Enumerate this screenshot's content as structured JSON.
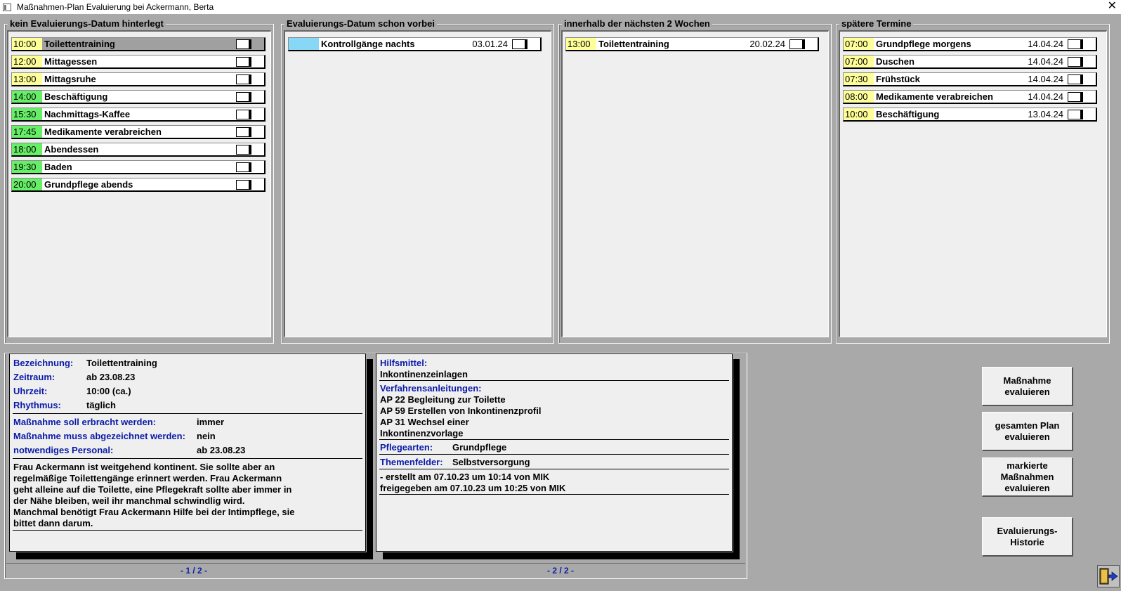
{
  "window": {
    "title": "Maßnahmen-Plan Evaluierung bei Ackermann, Berta",
    "close": "✕"
  },
  "colors": {
    "yellow": "#ffff99",
    "green": "#66ee66",
    "cyan": "#87d8f6"
  },
  "columns": {
    "kein": {
      "title": "kein Evaluierungs-Datum hinterlegt",
      "items": [
        {
          "time": "10:00",
          "label": "Toilettentraining",
          "color": "#ffff99"
        },
        {
          "time": "12:00",
          "label": "Mittagessen",
          "color": "#ffff99"
        },
        {
          "time": "13:00",
          "label": "Mittagsruhe",
          "color": "#ffff99"
        },
        {
          "time": "14:00",
          "label": "Beschäftigung",
          "color": "#66ee66"
        },
        {
          "time": "15:30",
          "label": "Nachmittags-Kaffee",
          "color": "#66ee66"
        },
        {
          "time": "17:45",
          "label": "Medikamente verabreichen",
          "color": "#66ee66"
        },
        {
          "time": "18:00",
          "label": "Abendessen",
          "color": "#66ee66"
        },
        {
          "time": "19:30",
          "label": "Baden",
          "color": "#66ee66"
        },
        {
          "time": "20:00",
          "label": "Grundpflege abends",
          "color": "#66ee66"
        }
      ]
    },
    "vorbei": {
      "title": "Evaluierungs-Datum schon vorbei",
      "items": [
        {
          "time": "",
          "label": "Kontrollgänge nachts",
          "date": "03.01.24",
          "color": "#87d8f6"
        }
      ]
    },
    "zwei_wochen": {
      "title": "innerhalb der nächsten 2 Wochen",
      "items": [
        {
          "time": "13:00",
          "label": "Toilettentraining",
          "date": "20.02.24",
          "color": "#ffff99"
        }
      ]
    },
    "spaeter": {
      "title": "spätere Termine",
      "items": [
        {
          "time": "07:00",
          "label": "Grundpflege morgens",
          "date": "14.04.24",
          "color": "#ffff99"
        },
        {
          "time": "07:00",
          "label": "Duschen",
          "date": "14.04.24",
          "color": "#ffff99"
        },
        {
          "time": "07:30",
          "label": "Frühstück",
          "date": "14.04.24",
          "color": "#ffff99"
        },
        {
          "time": "08:00",
          "label": "Medikamente verabreichen",
          "date": "14.04.24",
          "color": "#ffff99"
        },
        {
          "time": "10:00",
          "label": "Beschäftigung",
          "date": "13.04.24",
          "color": "#ffff99"
        }
      ]
    }
  },
  "detail": {
    "bezeichnung_label": "Bezeichnung:",
    "bezeichnung": "Toilettentraining",
    "zeitraum_label": "Zeitraum:",
    "zeitraum": "ab 23.08.23",
    "uhrzeit_label": "Uhrzeit:",
    "uhrzeit": "10:00 (ca.)",
    "rhythmus_label": "Rhythmus:",
    "rhythmus": "täglich",
    "erbracht_label": "Maßnahme soll erbracht werden:",
    "erbracht": "immer",
    "abgezeichnet_label": "Maßnahme muss abgezeichnet werden:",
    "abgezeichnet": "nein",
    "personal_label": "notwendiges Personal:",
    "personal": "ab 23.08.23",
    "beschreibung": [
      "Frau Ackermann ist weitgehend kontinent. Sie sollte aber an",
      "regelmäßige Toilettengänge erinnert werden. Frau Ackermann",
      "geht alleine auf die Toilette, eine Pflegekraft sollte aber immer in",
      "der Nähe bleiben, weil ihr manchmal schwindlig wird.",
      "Manchmal benötigt Frau Ackermann Hilfe bei der Intimpflege, sie",
      "bittet dann darum."
    ],
    "page1": "- 1 / 2 -",
    "hilfsmittel_label": "Hilfsmittel:",
    "hilfsmittel": "Inkontinenzeinlagen",
    "verfahren_label": "Verfahrensanleitungen:",
    "verfahren": [
      "AP 22 Begleitung zur Toilette",
      "AP 59 Erstellen von Inkontinenzprofil",
      "AP 31 Wechsel einer",
      "Inkontinenzvorlage"
    ],
    "pflegearten_label": "Pflegearten:",
    "pflegearten": "Grundpflege",
    "themen_label": "Themenfelder:",
    "themen": "Selbstversorgung",
    "erstellt": "- erstellt am 07.10.23 um 10:14 von MIK",
    "freigegeben": "freigegeben am 07.10.23 um 10:25 von MIK",
    "page2": "- 2 / 2 -"
  },
  "buttons": {
    "massnahme": "Maßnahme evaluieren",
    "plan": "gesamten Plan evaluieren",
    "markierte": "markierte Maßnahmen evaluieren",
    "historie": "Evaluierungs-Historie"
  }
}
